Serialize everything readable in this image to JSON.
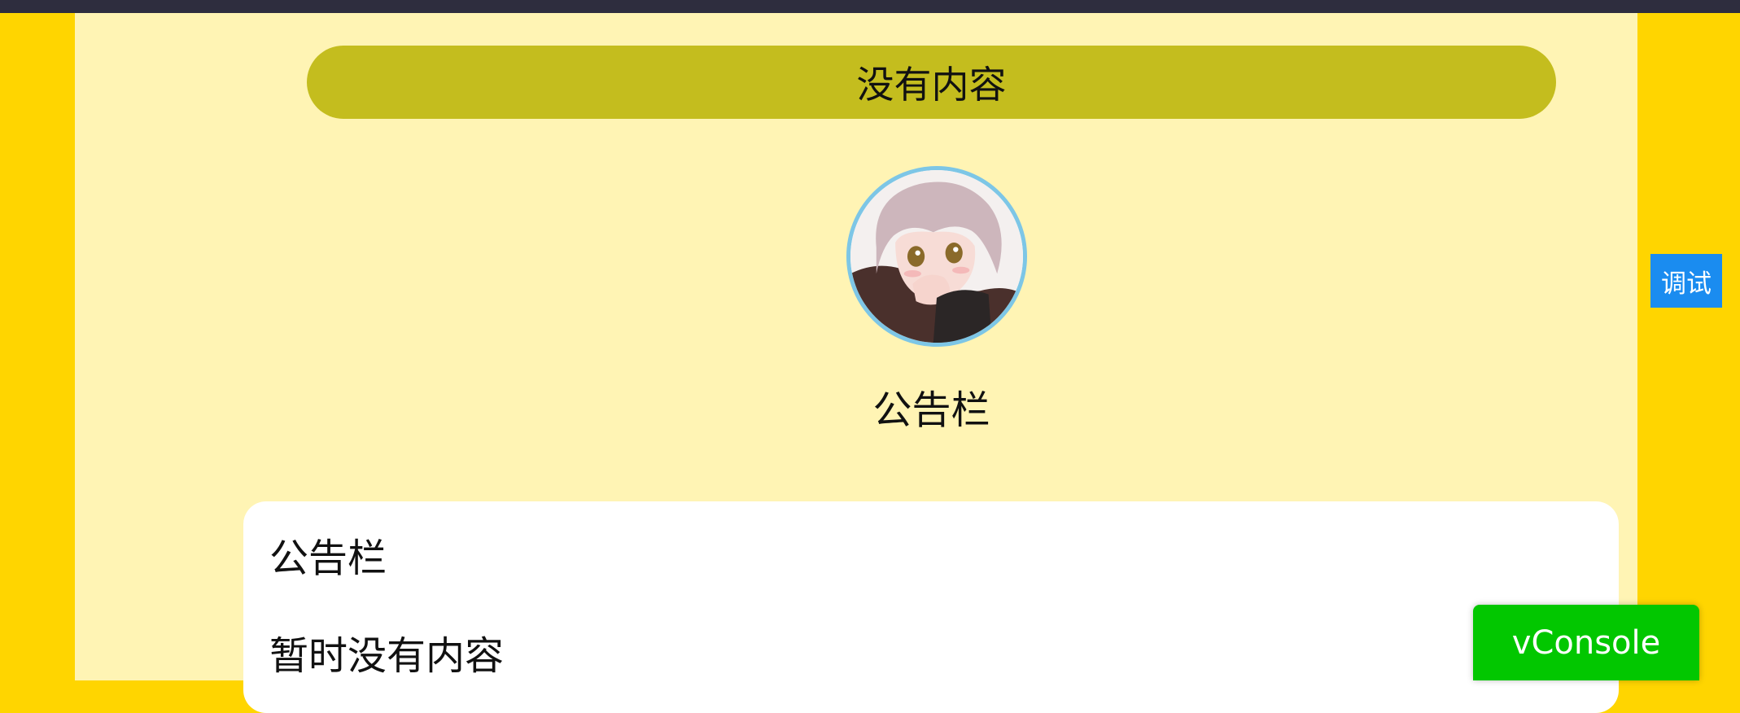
{
  "banner": {
    "text": "没有内容"
  },
  "avatar": {
    "icon": "anime-avatar-icon",
    "title": "公告栏"
  },
  "notice_card": {
    "title": "公告栏",
    "content": "暂时没有内容"
  },
  "debug_tab": {
    "label": "调试"
  },
  "vconsole": {
    "label": "vConsole"
  },
  "colors": {
    "page_background": "#FFD500",
    "content_background": "#FFF4B4",
    "banner_background": "#C4BD1E",
    "avatar_border": "#7DC6E6",
    "debug_tab_background": "#1A8CF0",
    "vconsole_background": "#02C700",
    "topbar": "#2E2D3E"
  }
}
